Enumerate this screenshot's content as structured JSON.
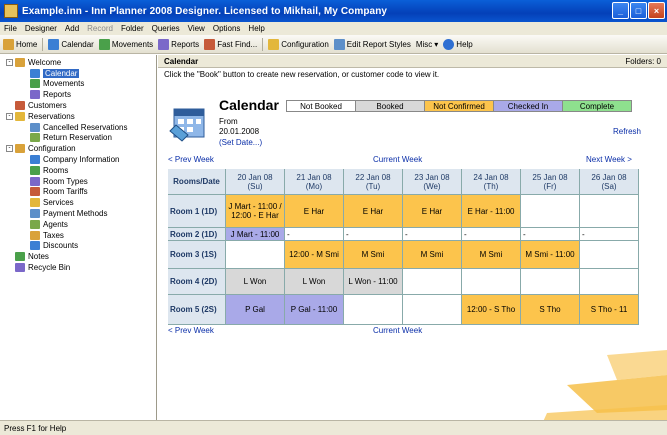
{
  "window": {
    "title": "Example.inn - Inn Planner 2008 Designer. Licensed to Mikhail, My Company",
    "buttons": [
      "_",
      "□",
      "×"
    ]
  },
  "menu": [
    "File",
    "Designer",
    "Add",
    "Record",
    "Folder",
    "Queries",
    "View",
    "Options",
    "Help"
  ],
  "toolbar": [
    {
      "label": "Home",
      "icon": "home-icon"
    },
    {
      "label": "Calendar",
      "icon": "calendar-icon"
    },
    {
      "label": "Movements",
      "icon": "movements-icon"
    },
    {
      "label": "Reports",
      "icon": "reports-icon"
    },
    {
      "label": "Fast Find...",
      "icon": "find-icon"
    },
    {
      "label": "Configuration",
      "icon": "configuration-icon"
    },
    {
      "label": "Edit Report Styles",
      "icon": "edit-styles-icon"
    },
    {
      "label": "Misc",
      "icon": "misc-icon"
    },
    {
      "label": "Help",
      "icon": "help-icon"
    }
  ],
  "tree": [
    {
      "label": "Welcome",
      "level": 0,
      "toggle": "-"
    },
    {
      "label": "Calendar",
      "level": 1,
      "selected": true
    },
    {
      "label": "Movements",
      "level": 1
    },
    {
      "label": "Reports",
      "level": 1
    },
    {
      "label": "Customers",
      "level": 0
    },
    {
      "label": "Reservations",
      "level": 0,
      "toggle": "-"
    },
    {
      "label": "Cancelled Reservations",
      "level": 1
    },
    {
      "label": "Return Reservation",
      "level": 1
    },
    {
      "label": "Configuration",
      "level": 0,
      "toggle": "-"
    },
    {
      "label": "Company Information",
      "level": 1
    },
    {
      "label": "Rooms",
      "level": 1
    },
    {
      "label": "Room Types",
      "level": 1
    },
    {
      "label": "Room Tariffs",
      "level": 1
    },
    {
      "label": "Services",
      "level": 1
    },
    {
      "label": "Payment Methods",
      "level": 1
    },
    {
      "label": "Agents",
      "level": 1
    },
    {
      "label": "Taxes",
      "level": 1
    },
    {
      "label": "Discounts",
      "level": 1
    },
    {
      "label": "Notes",
      "level": 0
    },
    {
      "label": "Recycle Bin",
      "level": 0
    }
  ],
  "main": {
    "header": "Calendar",
    "folders": "Folders: 0",
    "hint": "Click the \"Book\" button to create new reservation, or customer code to view it.",
    "title": "Calendar",
    "from_label": "From",
    "from_date": "20.01.2008",
    "set_date": "(Set Date...)",
    "refresh": "Refresh",
    "legend": [
      "Not Booked",
      "Booked",
      "Not Confirmed",
      "Checked In",
      "Complete"
    ],
    "prev_week": "< Prev Week",
    "current_week": "Current Week",
    "next_week": "Next Week >",
    "columns": [
      {
        "date": "20 Jan 08",
        "day": "(Su)"
      },
      {
        "date": "21 Jan 08",
        "day": "(Mo)"
      },
      {
        "date": "22 Jan 08",
        "day": "(Tu)"
      },
      {
        "date": "23 Jan 08",
        "day": "(We)"
      },
      {
        "date": "24 Jan 08",
        "day": "(Th)"
      },
      {
        "date": "25 Jan 08",
        "day": "(Fr)"
      },
      {
        "date": "26 Jan 08",
        "day": "(Sa)"
      }
    ],
    "rows_header": "Rooms/Date",
    "rooms": [
      {
        "label": "Room 1 (1D)",
        "cells": [
          "J Mart - 11:00 / 12:00 - E Har",
          "E Har",
          "E Har",
          "E Har",
          "E Har - 11:00",
          "",
          ""
        ]
      },
      {
        "label": "Room 2 (1D)",
        "cells": [
          "J Mart - 11:00",
          "-",
          "-",
          "-",
          "-",
          "-",
          "-"
        ]
      },
      {
        "label": "Room 3 (1S)",
        "cells": [
          "",
          "12:00 - M Smi",
          "M Smi",
          "M Smi",
          "M Smi",
          "M Smi - 11:00",
          ""
        ]
      },
      {
        "label": "Room 4 (2D)",
        "cells": [
          "L Won",
          "L Won",
          "L Won - 11:00",
          "",
          "",
          "",
          ""
        ]
      },
      {
        "label": "Room 5 (2S)",
        "cells": [
          "P Gal",
          "P Gal - 11:00",
          "",
          "",
          "12:00 - S Tho",
          "S Tho",
          "S Tho - 11"
        ]
      }
    ]
  },
  "status": "Press F1 for Help"
}
